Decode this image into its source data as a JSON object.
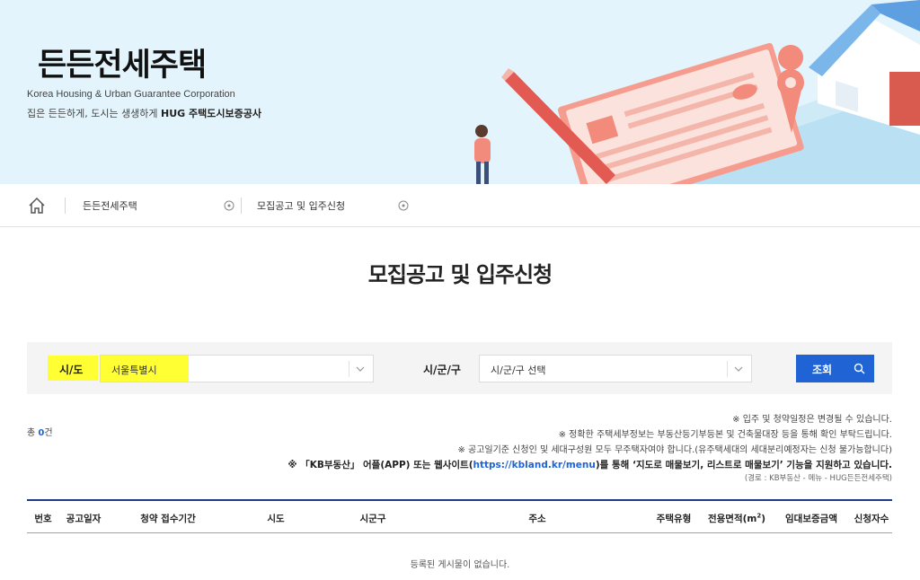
{
  "banner": {
    "title": "든든전세주택",
    "subtitle_en": "Korea Housing & Urban Guarantee Corporation",
    "subtitle_ko_pre": "집은 든든하게, 도시는 생생하게 ",
    "subtitle_ko_brand": "HUG 주택도시보증공사"
  },
  "breadcrumb": {
    "home_icon": "home-icon",
    "item1": "든든전세주택",
    "item2": "모집공고 및 입주신청"
  },
  "page": {
    "title": "모집공고 및 입주신청"
  },
  "filter": {
    "sido_label": "시/도",
    "sido_value": "서울특별시",
    "sigungu_label": "시/군/구",
    "sigungu_value": "시/군/구 선택",
    "search_label": "조회",
    "highlight_color": "#ffff33"
  },
  "list": {
    "total_pre": "총 ",
    "total_count": "0",
    "total_post": "건",
    "notices": [
      "※ 입주 및 청약일정은 변경될 수 있습니다.",
      "※ 정확한 주택세부정보는 부동산등기부등본 및 건축물대장 등을 통해 확인 부탁드립니다.",
      "※ 공고일기준 신청인 및 세대구성원 모두 무주택자여야 합니다.(유주택세대의 세대분리예정자는 신청 불가능합니다)"
    ],
    "kb_notice_pre": "※ 「KB부동산」 어플(APP) 또는 웹사이트(",
    "kb_notice_link": "https://kbland.kr/menu",
    "kb_notice_post": ")를 통해 ‘지도로 매물보기, 리스트로 매물보기’ 기능을 지원하고 있습니다.",
    "kb_path": "(경로 : KB부동산 - 메뉴 - HUG든든전세주택)",
    "columns": [
      "번호",
      "공고일자",
      "청약 접수기간",
      "시도",
      "시군구",
      "주소",
      "주택유형",
      "전용면적(m",
      "임대보증금액",
      "신청자수"
    ],
    "area_sup": "2",
    "area_close": ")",
    "empty_message": "등록된 게시물이 없습니다."
  },
  "colors": {
    "accent": "#1f63d4",
    "table_top_border": "#1f3a8a",
    "banner_bg": "#e3f4fc"
  }
}
